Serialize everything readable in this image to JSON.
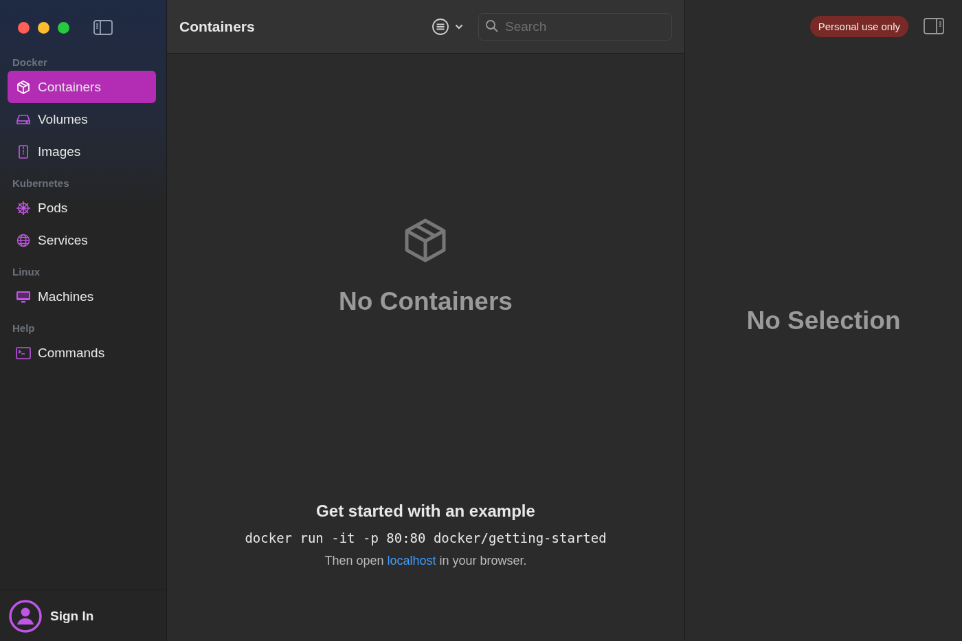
{
  "sidebar": {
    "sections": [
      {
        "title": "Docker",
        "items": [
          {
            "label": "Containers",
            "kind": "box",
            "selected": true
          },
          {
            "label": "Volumes",
            "kind": "drive",
            "selected": false
          },
          {
            "label": "Images",
            "kind": "archive",
            "selected": false
          }
        ]
      },
      {
        "title": "Kubernetes",
        "items": [
          {
            "label": "Pods",
            "kind": "wheel",
            "selected": false
          },
          {
            "label": "Services",
            "kind": "globe",
            "selected": false
          }
        ]
      },
      {
        "title": "Linux",
        "items": [
          {
            "label": "Machines",
            "kind": "monitor",
            "selected": false
          }
        ]
      },
      {
        "title": "Help",
        "items": [
          {
            "label": "Commands",
            "kind": "terminal",
            "selected": false
          }
        ]
      }
    ],
    "sign_in": "Sign In"
  },
  "toolbar": {
    "title": "Containers",
    "search": {
      "placeholder": "Search"
    }
  },
  "empty_state": {
    "title": "No Containers",
    "example_title": "Get started with an example",
    "command": "docker run -it -p 80:80 docker/getting-started",
    "hint_before": "Then open ",
    "hint_link": "localhost",
    "hint_after": " in your browser."
  },
  "detail": {
    "badge": "Personal use only",
    "empty": "No Selection"
  }
}
